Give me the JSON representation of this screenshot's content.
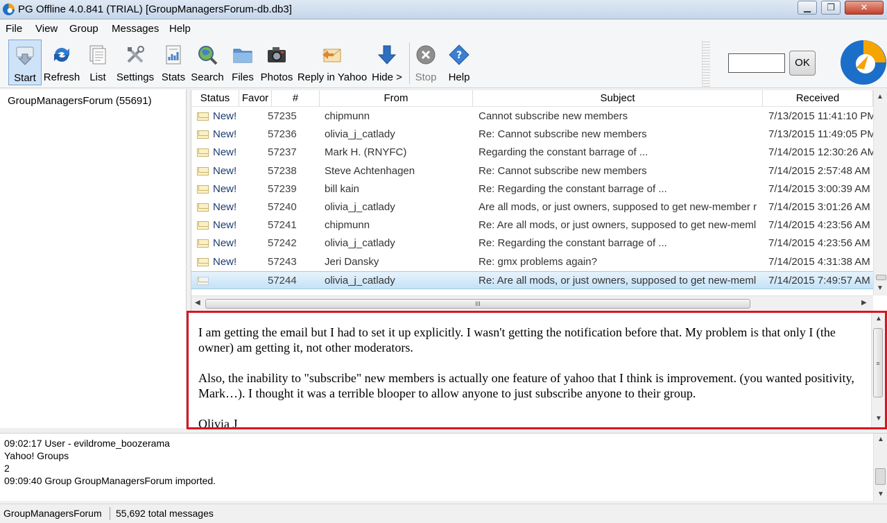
{
  "window": {
    "title": "PG Offline 4.0.841 (TRIAL) [GroupManagersForum-db.db3]",
    "minimize": "▁",
    "maximize": "❐",
    "close": "✕"
  },
  "menu": [
    "File",
    "View",
    "Group",
    "Messages",
    "Help"
  ],
  "toolbar": {
    "buttons": [
      "Start",
      "Refresh",
      "List",
      "Settings",
      "Stats",
      "Search",
      "Files",
      "Photos",
      "Reply in Yahoo",
      "Hide >",
      "Stop",
      "Help"
    ],
    "active": "Start",
    "disabled": "Stop",
    "go_value": "",
    "ok_label": "OK"
  },
  "groups": [
    {
      "label": "GroupManagersForum (55691)"
    }
  ],
  "message_list": {
    "columns": [
      "Status",
      "Favor",
      "#",
      "From",
      "Subject",
      "Received"
    ],
    "rows": [
      {
        "status": "New!",
        "num": "57235",
        "from": "chipmunn",
        "subject": "Cannot subscribe new members",
        "received": "7/13/2015 11:41:10 PM"
      },
      {
        "status": "New!",
        "num": "57236",
        "from": "olivia_j_catlady",
        "subject": "Re: Cannot subscribe new members",
        "received": "7/13/2015 11:49:05 PM"
      },
      {
        "status": "New!",
        "num": "57237",
        "from": "Mark H. (RNYFC)",
        "subject": "Regarding the constant barrage of ...",
        "received": "7/14/2015 12:30:26 AM"
      },
      {
        "status": "New!",
        "num": "57238",
        "from": "Steve Achtenhagen",
        "subject": "Re: Cannot subscribe new members",
        "received": "7/14/2015 2:57:48 AM"
      },
      {
        "status": "New!",
        "num": "57239",
        "from": "bill kain",
        "subject": "Re: Regarding the constant barrage of ...",
        "received": "7/14/2015 3:00:39 AM"
      },
      {
        "status": "New!",
        "num": "57240",
        "from": "olivia_j_catlady",
        "subject": "Are all mods, or just owners, supposed to get new-member r",
        "received": "7/14/2015 3:01:26 AM"
      },
      {
        "status": "New!",
        "num": "57241",
        "from": "chipmunn",
        "subject": "Re: Are all mods, or just owners, supposed to get new-meml",
        "received": "7/14/2015 4:23:56 AM"
      },
      {
        "status": "New!",
        "num": "57242",
        "from": "olivia_j_catlady",
        "subject": "Re: Regarding the constant barrage of ...",
        "received": "7/14/2015 4:23:56 AM"
      },
      {
        "status": "New!",
        "num": "57243",
        "from": "Jeri Dansky",
        "subject": "Re: gmx problems again?",
        "received": "7/14/2015 4:31:38 AM"
      },
      {
        "status": "",
        "num": "57244",
        "from": "olivia_j_catlady",
        "subject": "Re: Are all mods, or just owners, supposed to get new-meml",
        "received": "7/14/2015 7:49:57 AM",
        "selected": true
      }
    ],
    "scroll_grip": "III"
  },
  "preview": {
    "paragraphs": [
      "I am getting the email but I had to set it up explicitly. I wasn't getting the notification before that. My problem is that only I (the owner) am getting it, not other moderators.",
      "Also, the inability to \"subscribe\" new members is actually one feature of yahoo that I think is improvement. (you wanted positivity, Mark…). I thought it was a terrible blooper to allow anyone to just subscribe anyone to their group.",
      "Olivia J"
    ],
    "scroll_grip": "≡"
  },
  "log": [
    "09:02:17 User - evildrome_boozerama",
    "Yahoo! Groups",
    "2",
    "09:09:40 Group GroupManagersForum imported."
  ],
  "statusbar": {
    "group": "GroupManagersForum",
    "total": "55,692 total messages"
  },
  "colors": {
    "accent": "#1b6fc8",
    "preview_border": "#d9151f",
    "selection": "#c4e2f7"
  }
}
